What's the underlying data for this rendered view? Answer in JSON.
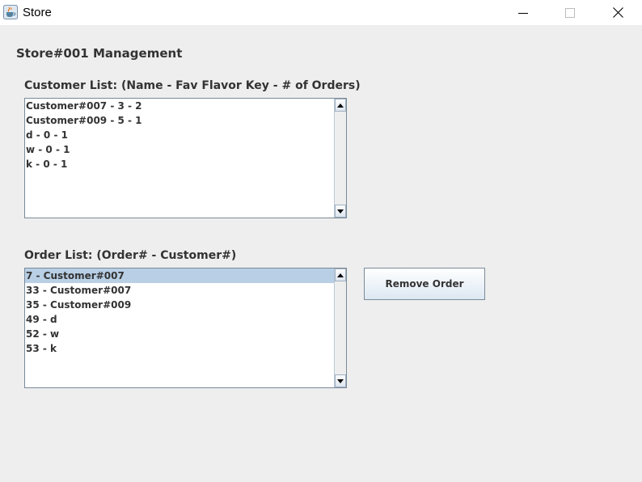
{
  "window": {
    "title": "Store",
    "app_icon": "java-cup-icon"
  },
  "page": {
    "title": "Store#001 Management"
  },
  "customers": {
    "label": "Customer List: (Name - Fav Flavor Key - # of Orders)",
    "items": [
      {
        "text": "Customer#007 - 3 - 2"
      },
      {
        "text": "Customer#009 - 5 - 1"
      },
      {
        "text": "d - 0 - 1"
      },
      {
        "text": "w - 0 - 1"
      },
      {
        "text": "k - 0 - 1"
      }
    ]
  },
  "orders": {
    "label": "Order List: (Order# - Customer#)",
    "selected_item": "7 - Customer#007",
    "items": [
      {
        "text": "7 - Customer#007"
      },
      {
        "text": "33 - Customer#007"
      },
      {
        "text": "35 - Customer#009"
      },
      {
        "text": "49 - d"
      },
      {
        "text": "52 - w"
      },
      {
        "text": "53 - k"
      }
    ]
  },
  "actions": {
    "remove_order_label": "Remove Order"
  },
  "colors": {
    "background": "#eeeeee",
    "selection": "#b8cfe5",
    "text": "#333333",
    "border": "#7a8a99"
  }
}
